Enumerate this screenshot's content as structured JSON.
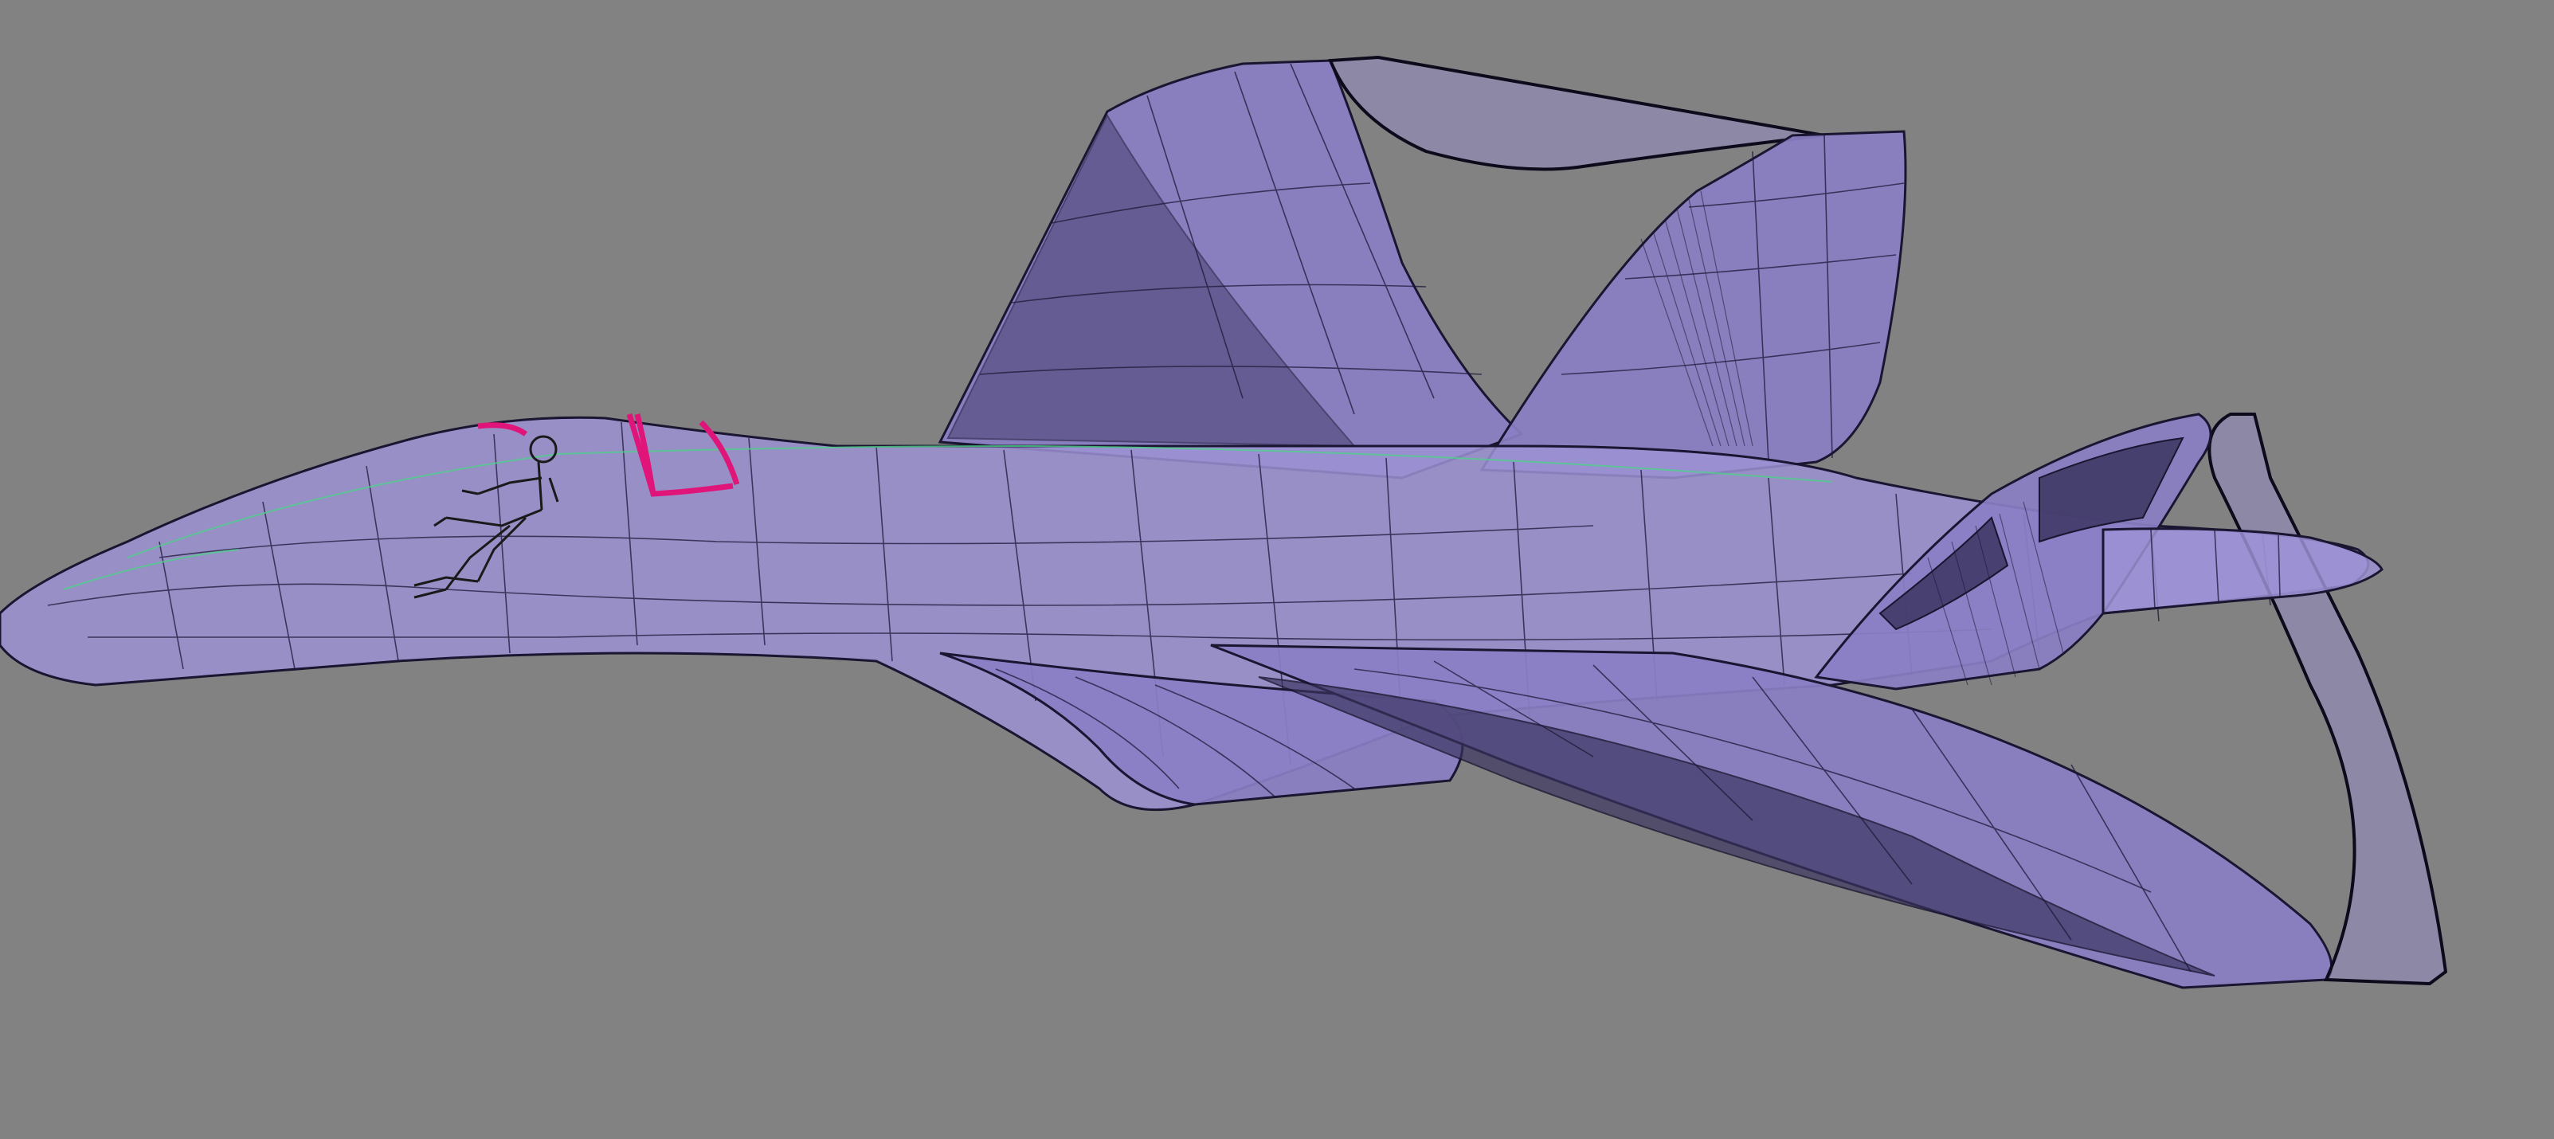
{
  "viewport": {
    "background": "#828282",
    "model_color": "#8a7fc4",
    "canopy_color": "#e0157a",
    "mesh_line_color": "#1a1530"
  }
}
